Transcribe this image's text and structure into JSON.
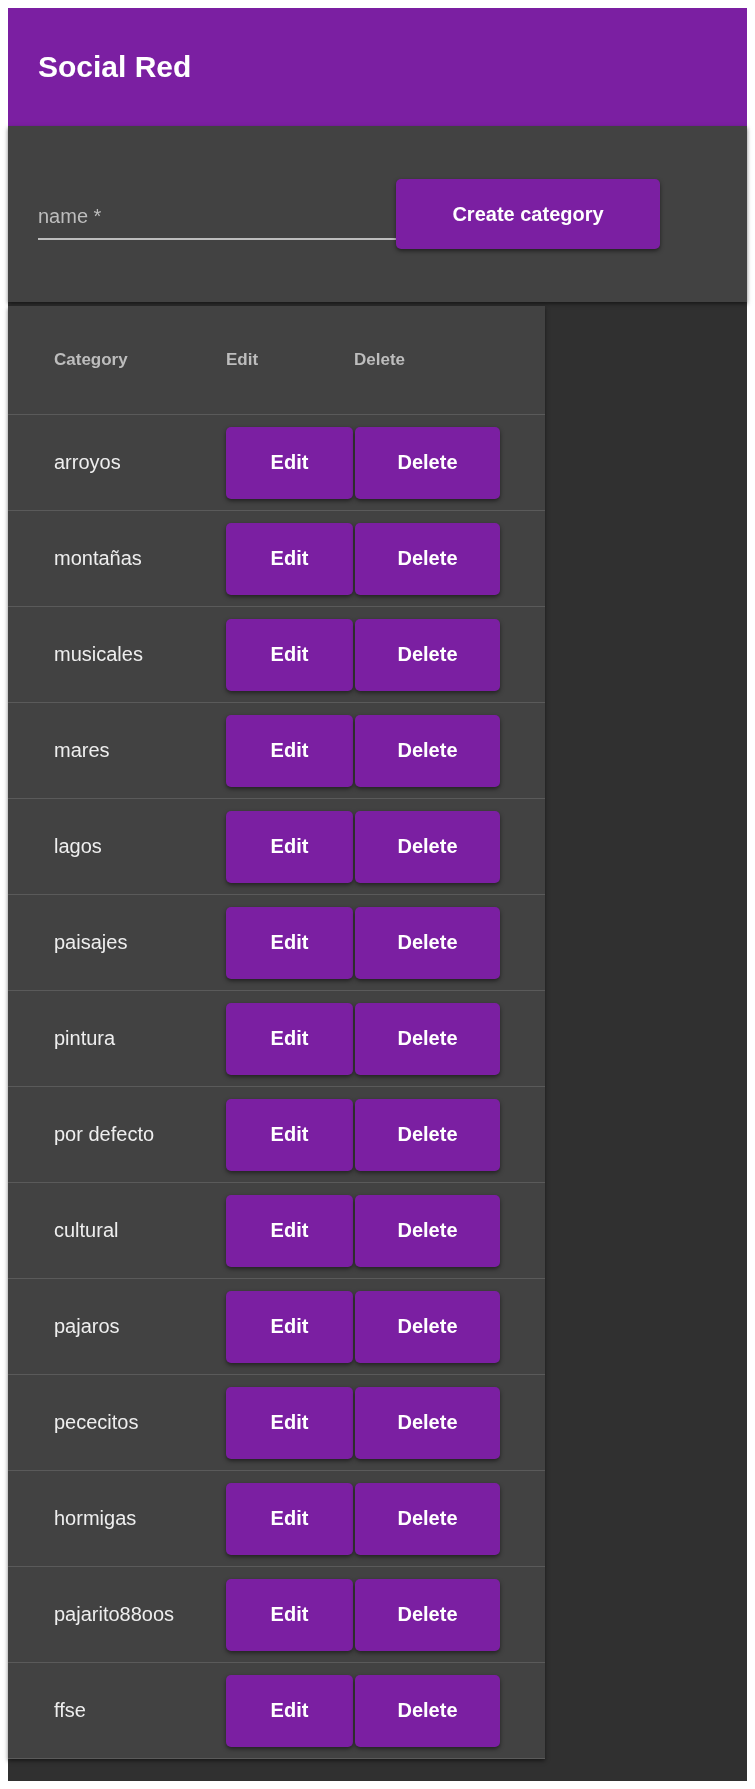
{
  "app_bar": {
    "title": "Social Red"
  },
  "form": {
    "name_field": {
      "placeholder": "name *"
    },
    "create_button": "Create category"
  },
  "table": {
    "columns": [
      "Category",
      "Edit",
      "Delete"
    ],
    "rows": [
      {
        "name": "arroyos",
        "edit": "Edit",
        "delete": "Delete"
      },
      {
        "name": "montañas",
        "edit": "Edit",
        "delete": "Delete"
      },
      {
        "name": "musicales",
        "edit": "Edit",
        "delete": "Delete"
      },
      {
        "name": "mares",
        "edit": "Edit",
        "delete": "Delete"
      },
      {
        "name": "lagos",
        "edit": "Edit",
        "delete": "Delete"
      },
      {
        "name": "paisajes",
        "edit": "Edit",
        "delete": "Delete"
      },
      {
        "name": "pintura",
        "edit": "Edit",
        "delete": "Delete"
      },
      {
        "name": "por defecto",
        "edit": "Edit",
        "delete": "Delete"
      },
      {
        "name": "cultural",
        "edit": "Edit",
        "delete": "Delete"
      },
      {
        "name": "pajaros",
        "edit": "Edit",
        "delete": "Delete"
      },
      {
        "name": "pececitos",
        "edit": "Edit",
        "delete": "Delete"
      },
      {
        "name": "hormigas",
        "edit": "Edit",
        "delete": "Delete"
      },
      {
        "name": "pajarito88oos",
        "edit": "Edit",
        "delete": "Delete"
      },
      {
        "name": "ffse",
        "edit": "Edit",
        "delete": "Delete"
      }
    ]
  }
}
